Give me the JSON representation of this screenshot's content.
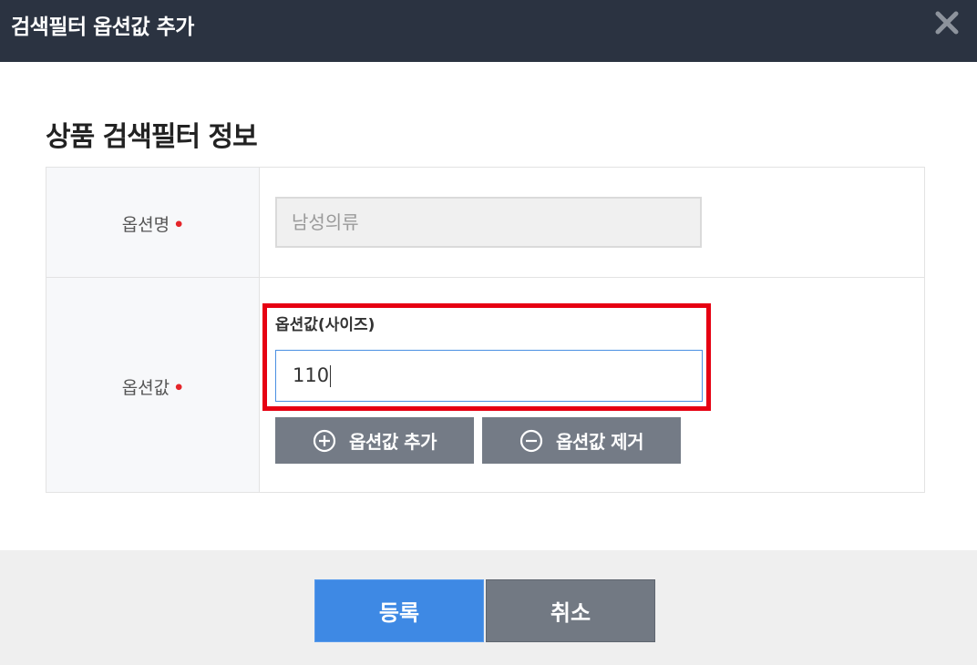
{
  "dialog": {
    "title": "검색필터 옵션값 추가"
  },
  "section": {
    "title": "상품 검색필터 정보"
  },
  "form": {
    "option_name": {
      "label": "옵션명",
      "required_mark": "•",
      "value": "남성의류"
    },
    "option_value": {
      "label": "옵션값",
      "required_mark": "•",
      "field_label": "옵션값(사이즈)",
      "value": "110"
    },
    "add_button_label": "옵션값 추가",
    "remove_button_label": "옵션값 제거"
  },
  "footer": {
    "register_label": "등록",
    "cancel_label": "취소"
  },
  "colors": {
    "titlebar": "#2b3341",
    "primary": "#3e89e4",
    "secondary": "#727983",
    "highlight": "#e60012",
    "required": "#e5252a"
  },
  "icons": {
    "close": "close-icon",
    "add": "plus-circle-icon",
    "remove": "minus-circle-icon"
  }
}
